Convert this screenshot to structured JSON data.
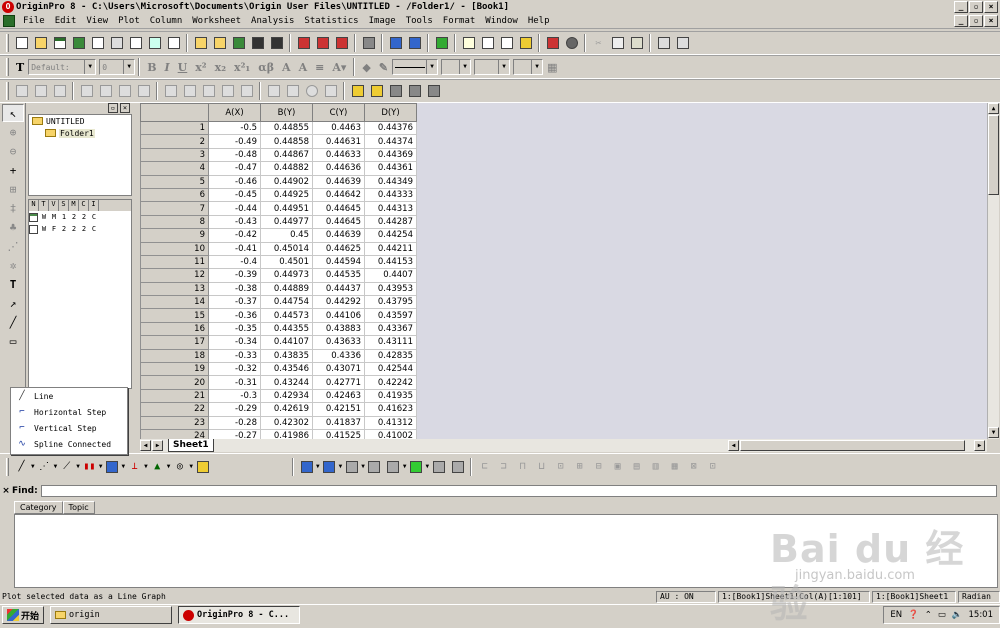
{
  "window": {
    "title": "OriginPro 8 - C:\\Users\\Microsoft\\Documents\\Origin User Files\\UNTITLED - /Folder1/ - [Book1]"
  },
  "menu": [
    "File",
    "Edit",
    "View",
    "Plot",
    "Column",
    "Worksheet",
    "Analysis",
    "Statistics",
    "Image",
    "Tools",
    "Format",
    "Window",
    "Help"
  ],
  "format_toolbar": {
    "font": "Default:",
    "size": "0"
  },
  "project_explorer": {
    "root": "UNTITLED",
    "folder": "Folder1",
    "list_headers": [
      "N",
      "T",
      "V",
      "S",
      "M",
      "C",
      "I"
    ],
    "rows": [
      {
        "cells": [
          "W",
          "M",
          "1",
          "2",
          "2",
          "C"
        ]
      },
      {
        "cells": [
          "W",
          "F",
          "2",
          "2",
          "2",
          "C"
        ]
      }
    ]
  },
  "plot_popup": [
    "Line",
    "Horizontal Step",
    "Vertical Step",
    "Spline Connected"
  ],
  "worksheet": {
    "columns": [
      "A(X)",
      "B(Y)",
      "C(Y)",
      "D(Y)"
    ],
    "rows": [
      [
        "1",
        "-0.5",
        "0.44855",
        "0.4463",
        "0.44376"
      ],
      [
        "2",
        "-0.49",
        "0.44858",
        "0.44631",
        "0.44374"
      ],
      [
        "3",
        "-0.48",
        "0.44867",
        "0.44633",
        "0.44369"
      ],
      [
        "4",
        "-0.47",
        "0.44882",
        "0.44636",
        "0.44361"
      ],
      [
        "5",
        "-0.46",
        "0.44902",
        "0.44639",
        "0.44349"
      ],
      [
        "6",
        "-0.45",
        "0.44925",
        "0.44642",
        "0.44333"
      ],
      [
        "7",
        "-0.44",
        "0.44951",
        "0.44645",
        "0.44313"
      ],
      [
        "8",
        "-0.43",
        "0.44977",
        "0.44645",
        "0.44287"
      ],
      [
        "9",
        "-0.42",
        "0.45",
        "0.44639",
        "0.44254"
      ],
      [
        "10",
        "-0.41",
        "0.45014",
        "0.44625",
        "0.44211"
      ],
      [
        "11",
        "-0.4",
        "0.4501",
        "0.44594",
        "0.44153"
      ],
      [
        "12",
        "-0.39",
        "0.44973",
        "0.44535",
        "0.4407"
      ],
      [
        "13",
        "-0.38",
        "0.44889",
        "0.44437",
        "0.43953"
      ],
      [
        "14",
        "-0.37",
        "0.44754",
        "0.44292",
        "0.43795"
      ],
      [
        "15",
        "-0.36",
        "0.44573",
        "0.44106",
        "0.43597"
      ],
      [
        "16",
        "-0.35",
        "0.44355",
        "0.43883",
        "0.43367"
      ],
      [
        "17",
        "-0.34",
        "0.44107",
        "0.43633",
        "0.43111"
      ],
      [
        "18",
        "-0.33",
        "0.43835",
        "0.4336",
        "0.42835"
      ],
      [
        "19",
        "-0.32",
        "0.43546",
        "0.43071",
        "0.42544"
      ],
      [
        "20",
        "-0.31",
        "0.43244",
        "0.42771",
        "0.42242"
      ],
      [
        "21",
        "-0.3",
        "0.42934",
        "0.42463",
        "0.41935"
      ],
      [
        "22",
        "-0.29",
        "0.42619",
        "0.42151",
        "0.41623"
      ],
      [
        "23",
        "-0.28",
        "0.42302",
        "0.41837",
        "0.41312"
      ],
      [
        "24",
        "-0.27",
        "0.41986",
        "0.41525",
        "0.41002"
      ]
    ],
    "sheet_tab": "Sheet1"
  },
  "find": {
    "label": "Find:",
    "value": "",
    "tabs": [
      "Category",
      "Topic"
    ]
  },
  "status": {
    "message": "Plot selected data as a Line Graph",
    "au": "AU : ON",
    "pane2": "1:[Book1]Sheet1!Col(A)[1:101]",
    "pane3": "1:[Book1]Sheet1",
    "angle": "Radian"
  },
  "taskbar": {
    "start": "开始",
    "tasks": [
      "origin",
      "OriginPro 8 - C..."
    ],
    "lang": "EN",
    "clock": "15:01"
  },
  "watermark": {
    "main": "Bai du 经验",
    "sub": "jingyan.baidu.com"
  }
}
